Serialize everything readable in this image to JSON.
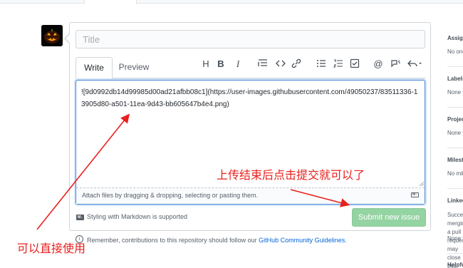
{
  "issue_form": {
    "title_placeholder": "Title",
    "tabs": [
      {
        "label": "Write"
      },
      {
        "label": "Preview"
      }
    ],
    "toolbar_icons": [
      "heading-icon",
      "bold-icon",
      "italic-icon",
      "quote-icon",
      "code-icon",
      "link-icon",
      "bulleted-list-icon",
      "numbered-list-icon",
      "task-list-icon",
      "mention-icon",
      "reference-icon",
      "reply-icon"
    ],
    "body_text": "![9d0992db14d99985d00ad21afbb08c1](https://user-images.githubusercontent.com/49050237/83511336-13905d80-a501-11ea-9d43-bb605647b4e4.png)",
    "attach_text": "Attach files by dragging & dropping, selecting or pasting them.",
    "markdown_note": "Styling with Markdown is supported",
    "submit_label": "Submit new issue",
    "contrib_note_prefix": "Remember, contributions to this repository should follow our",
    "contrib_note_link": "GitHub Community Guidelines",
    "contrib_note_suffix": "."
  },
  "sidebar": {
    "sections": [
      {
        "heading": "Assignees",
        "value": "No one"
      },
      {
        "heading": "Labels",
        "value": "None yet"
      },
      {
        "heading": "Projects",
        "value": "None yet"
      },
      {
        "heading": "Milestone",
        "value": "No milestone"
      },
      {
        "heading": "Linked pull requests",
        "value": "Successfully merging a pull request may close this issue."
      },
      {
        "heading": "",
        "value": "None yet"
      },
      {
        "heading": "Helpful resources",
        "value": ""
      }
    ]
  },
  "annotations": {
    "upload_done": "上传结束后点击提交就可以了",
    "use_directly": "可以直接使用"
  },
  "colors": {
    "annotation_red": "#e8201d",
    "submit_green_disabled": "#94d3a2",
    "link_blue": "#0366d6",
    "focus_blue": "#4a8ad4"
  }
}
